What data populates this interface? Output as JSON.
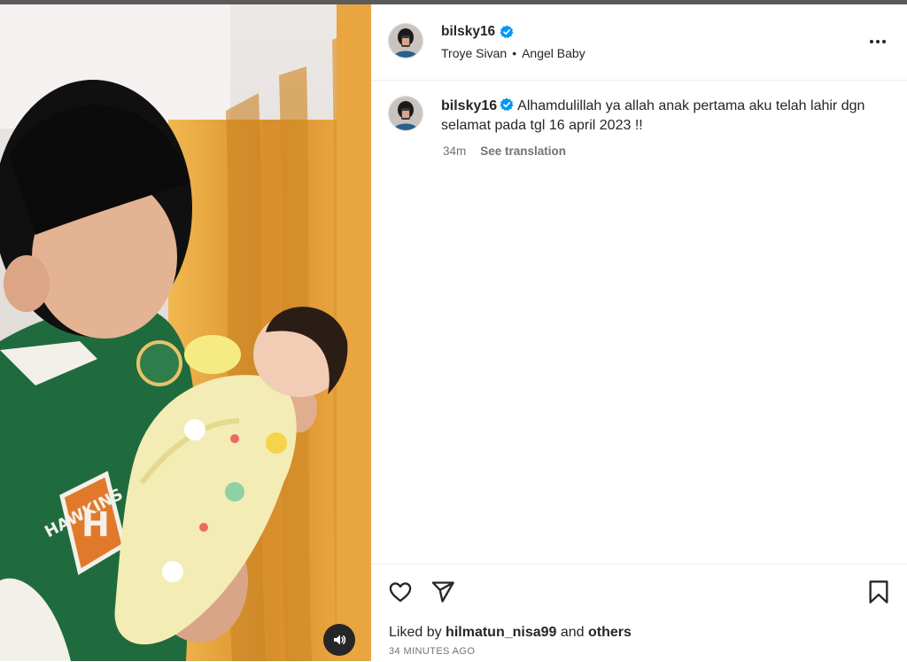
{
  "post": {
    "username": "bilsky16",
    "verified": true,
    "audio": {
      "artist": "Troye Sivan",
      "separator": "•",
      "track": "Angel Baby"
    },
    "caption": {
      "username": "bilsky16",
      "text": "Alhamdulillah ya allah anak pertama aku telah lahir dgn selamat pada tgl 16 april 2023 !!",
      "age": "34m",
      "see_translation": "See translation"
    },
    "likes": {
      "prefix": "Liked by",
      "user": "hilmatun_nisa99",
      "conjunction": "and",
      "others": "others"
    },
    "timestamp": "34 minutes ago"
  },
  "media": {
    "type": "video",
    "jacket_text": "HAWKINS",
    "jacket_letter": "H"
  },
  "icons": {
    "more": "more-horizontal-icon",
    "like": "heart-icon",
    "share": "send-icon",
    "save": "bookmark-icon",
    "audio": "speaker-icon",
    "verified": "verified-badge-icon"
  },
  "colors": {
    "verified_blue": "#0095f6",
    "text_primary": "#262626",
    "text_secondary": "#737373",
    "divider": "#efefef",
    "jacket_green": "#1f6b3e",
    "curtain_orange": "#e9a53a"
  }
}
